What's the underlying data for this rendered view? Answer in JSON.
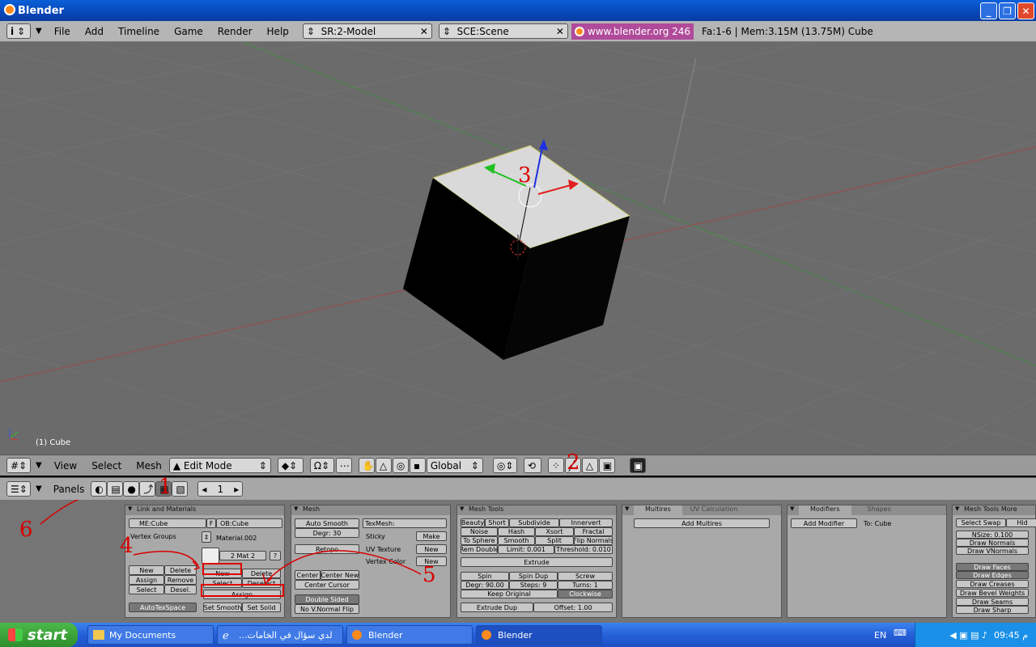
{
  "window": {
    "title": "Blender"
  },
  "menubar": {
    "menus": [
      "File",
      "Add",
      "Timeline",
      "Game",
      "Render",
      "Help"
    ],
    "screen": "SR:2-Model",
    "scene": "SCE:Scene",
    "link": "www.blender.org 246",
    "stats": "Fa:1-6 | Mem:3.15M (13.75M) Cube"
  },
  "viewport": {
    "object_label": "(1) Cube",
    "annotation": "3"
  },
  "header3d": {
    "menus": [
      "View",
      "Select",
      "Mesh"
    ],
    "mode": "Edit Mode",
    "orientation": "Global",
    "annotation": "2"
  },
  "buttons_header": {
    "panels_label": "Panels",
    "frame": "1",
    "annotation": "1"
  },
  "link_materials": {
    "title": "Link and Materials",
    "me": "ME:Cube",
    "f": "F",
    "ob": "OB:Cube",
    "vertex_groups": "Vertex Groups",
    "material": "Material.002",
    "mat_count": "2 Mat 2",
    "q": "?",
    "vg_buttons": [
      "New",
      "Delete",
      "Assign",
      "Remove",
      "Select",
      "Desel."
    ],
    "mat_new": "New",
    "mat_delete": "Delete",
    "mat_select": "Select",
    "mat_deselect": "Deselect",
    "mat_assign": "Assign",
    "autotex": "AutoTexSpace",
    "set_smooth": "Set Smooth",
    "set_solid": "Set Solid"
  },
  "mesh": {
    "title": "Mesh",
    "auto_smooth": "Auto Smooth",
    "degr": "Degr: 30",
    "retopo": "Retopo",
    "texmesh": "TexMesh:",
    "sticky": "Sticky",
    "make": "Make",
    "uv_texture": "UV Texture",
    "new1": "New",
    "vertex_color": "Vertex Color",
    "new2": "New",
    "center": "Center",
    "center_new": "Center New",
    "center_cursor": "Center Cursor",
    "double_sided": "Double Sided",
    "no_vnormal": "No V.Normal Flip"
  },
  "mesh_tools": {
    "title": "Mesh Tools",
    "row1": [
      "Beauty",
      "Short",
      "Subdivide",
      "Innervert"
    ],
    "row2": [
      "Noise",
      "Hash",
      "Xsort",
      "Fractal"
    ],
    "row3": [
      "To Sphere",
      "Smooth",
      "Split",
      "Flip Normals"
    ],
    "row4": [
      "Rem Double",
      "Limit: 0.001",
      "Threshold: 0.010"
    ],
    "extrude": "Extrude",
    "row5": [
      "Spin",
      "Spin Dup",
      "Screw"
    ],
    "row6": [
      "Degr: 90.00",
      "Steps: 9",
      "Turns: 1"
    ],
    "keep_original": "Keep Original",
    "clockwise": "Clockwise",
    "extrude_dup": "Extrude Dup",
    "offset": "Offset: 1.00"
  },
  "multires": {
    "tab1": "Multires",
    "tab2": "UV Calculation",
    "add": "Add Multires"
  },
  "modifiers": {
    "tab1": "Modifiers",
    "tab2": "Shapes",
    "add": "Add Modifier",
    "to": "To: Cube"
  },
  "mesh_tools_more": {
    "title": "Mesh Tools More",
    "select_swap": "Select Swap",
    "hide": "Hid",
    "nsize": "NSize: 0.100",
    "items": [
      "Draw Normals",
      "Draw VNormals"
    ],
    "draw_items": [
      "Draw Faces",
      "Draw Edges",
      "Draw Creases",
      "Draw Bevel Weights",
      "Draw Seams",
      "Draw Sharp"
    ]
  },
  "annotations": {
    "a4": "4",
    "a5": "5",
    "a6": "6"
  },
  "taskbar": {
    "start": "start",
    "tasks": [
      "My Documents",
      "...لدي سؤال في الخامات",
      "Blender",
      "Blender"
    ],
    "lang": "EN",
    "clock": "09:45 م"
  }
}
